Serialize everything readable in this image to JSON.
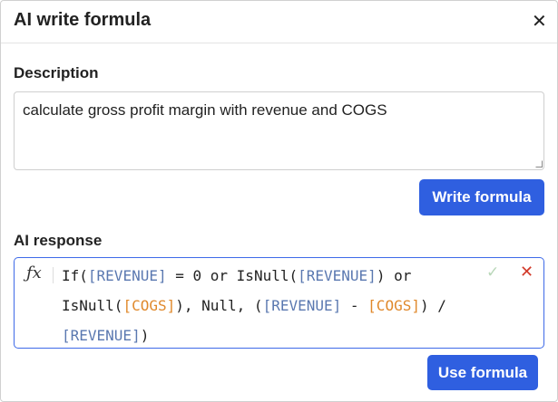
{
  "dialog": {
    "title": "AI write formula",
    "close_icon": "close-icon"
  },
  "description": {
    "label": "Description",
    "value": "calculate gross profit margin with revenue and COGS"
  },
  "write_button": "Write formula",
  "ai_response": {
    "label": "AI response",
    "fx_icon": "fx",
    "formula_tokens": [
      {
        "t": "If(",
        "c": "plain"
      },
      {
        "t": "[REVENUE]",
        "c": "field-blue"
      },
      {
        "t": " = 0 or IsNull(",
        "c": "plain"
      },
      {
        "t": "[REVENUE]",
        "c": "field-blue"
      },
      {
        "t": ") or IsNull(",
        "c": "plain"
      },
      {
        "t": "[COGS]",
        "c": "field-orange"
      },
      {
        "t": "), Null, (",
        "c": "plain"
      },
      {
        "t": "[REVENUE]",
        "c": "field-blue"
      },
      {
        "t": " - ",
        "c": "plain"
      },
      {
        "t": "[COGS]",
        "c": "field-orange"
      },
      {
        "t": ") / ",
        "c": "plain"
      },
      {
        "t": "[REVENUE]",
        "c": "field-blue"
      },
      {
        "t": ")",
        "c": "plain"
      }
    ],
    "accept_icon": "✓",
    "reject_icon": "✕"
  },
  "use_button": "Use formula",
  "colors": {
    "accent": "#2f5fe0",
    "field_blue": "#5a78b0",
    "field_orange": "#e0892c"
  }
}
